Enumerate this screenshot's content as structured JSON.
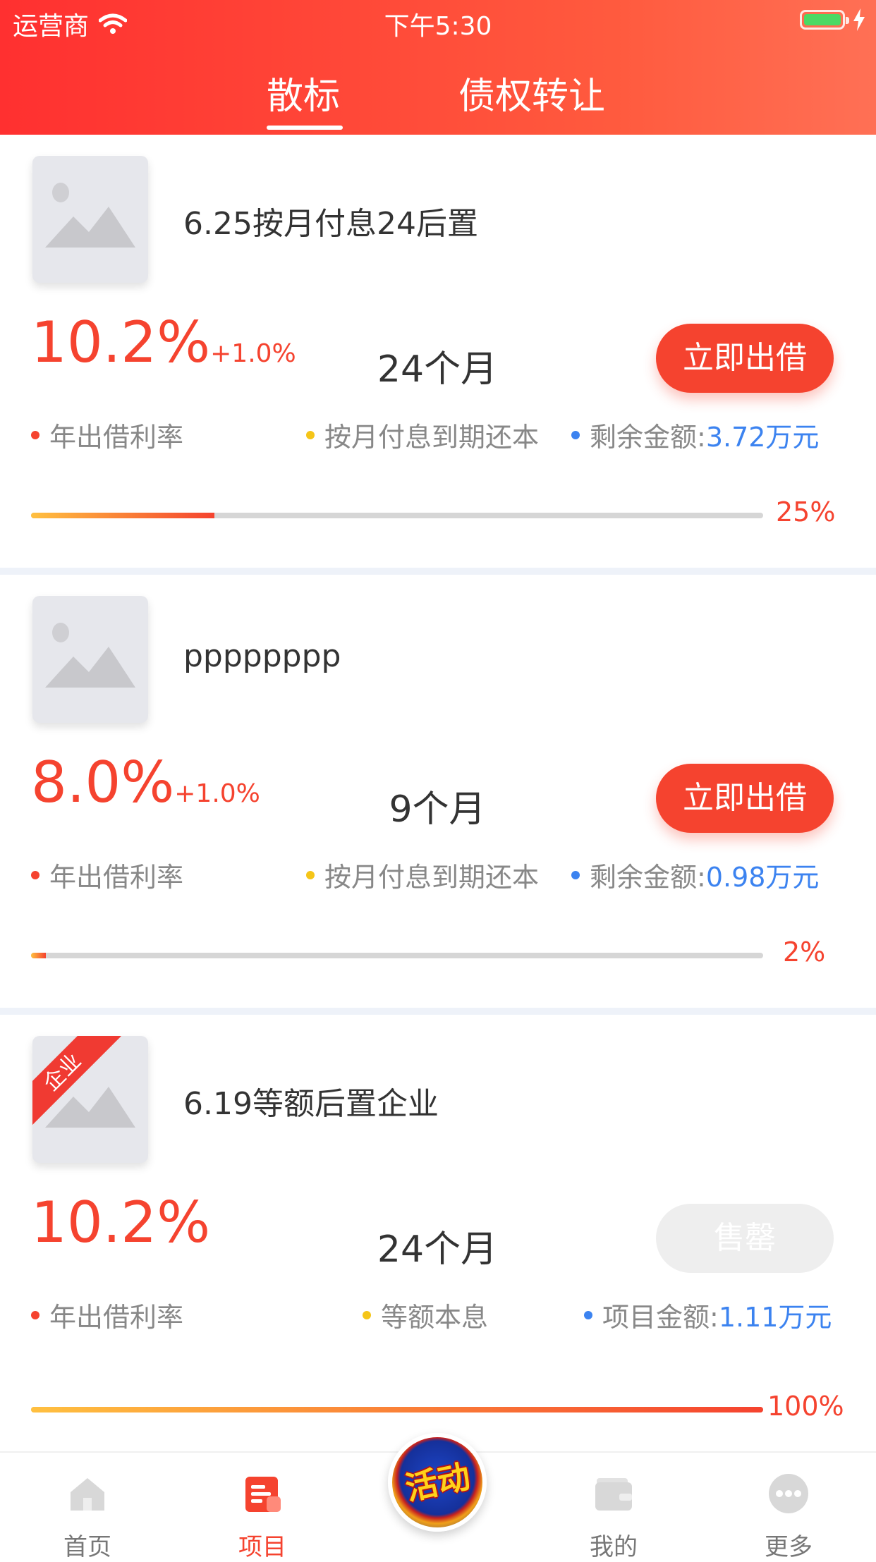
{
  "status_bar": {
    "carrier": "运营商",
    "time": "下午5:30"
  },
  "tabs": {
    "first": "散标",
    "second": "债权转让"
  },
  "cards": [
    {
      "title": "6.25按月付息24后置",
      "rate_main": "10.2%",
      "rate_extra": "+1.0%",
      "term": "24个月",
      "button": "立即出借",
      "rate_label": "年出借利率",
      "repay_label": "按月付息到期还本",
      "amount_label": "剩余金额:",
      "amount_value": "3.72万元",
      "progress_text": "25%",
      "progress": 0.25
    },
    {
      "title": "pppppppp",
      "rate_main": "8.0%",
      "rate_extra": "+1.0%",
      "term": "9个月",
      "button": "立即出借",
      "rate_label": "年出借利率",
      "repay_label": "按月付息到期还本",
      "amount_label": "剩余金额:",
      "amount_value": "0.98万元",
      "progress_text": "2%",
      "progress": 0.02
    },
    {
      "badge": "企业",
      "title": "6.19等额后置企业",
      "rate_main": "10.2%",
      "term": "24个月",
      "button": "售罄",
      "rate_label": "年出借利率",
      "repay_label": "等额本息",
      "amount_label": "项目金额:",
      "amount_value": "1.11万元",
      "progress_text": "100%",
      "progress": 1.0
    }
  ],
  "tabbar": {
    "home": "首页",
    "project": "项目",
    "activity": "活动",
    "mine": "我的",
    "more": "更多"
  },
  "colors": {
    "accent": "#f5432f",
    "link_blue": "#3c83f0",
    "dot_yellow": "#f5c518"
  }
}
